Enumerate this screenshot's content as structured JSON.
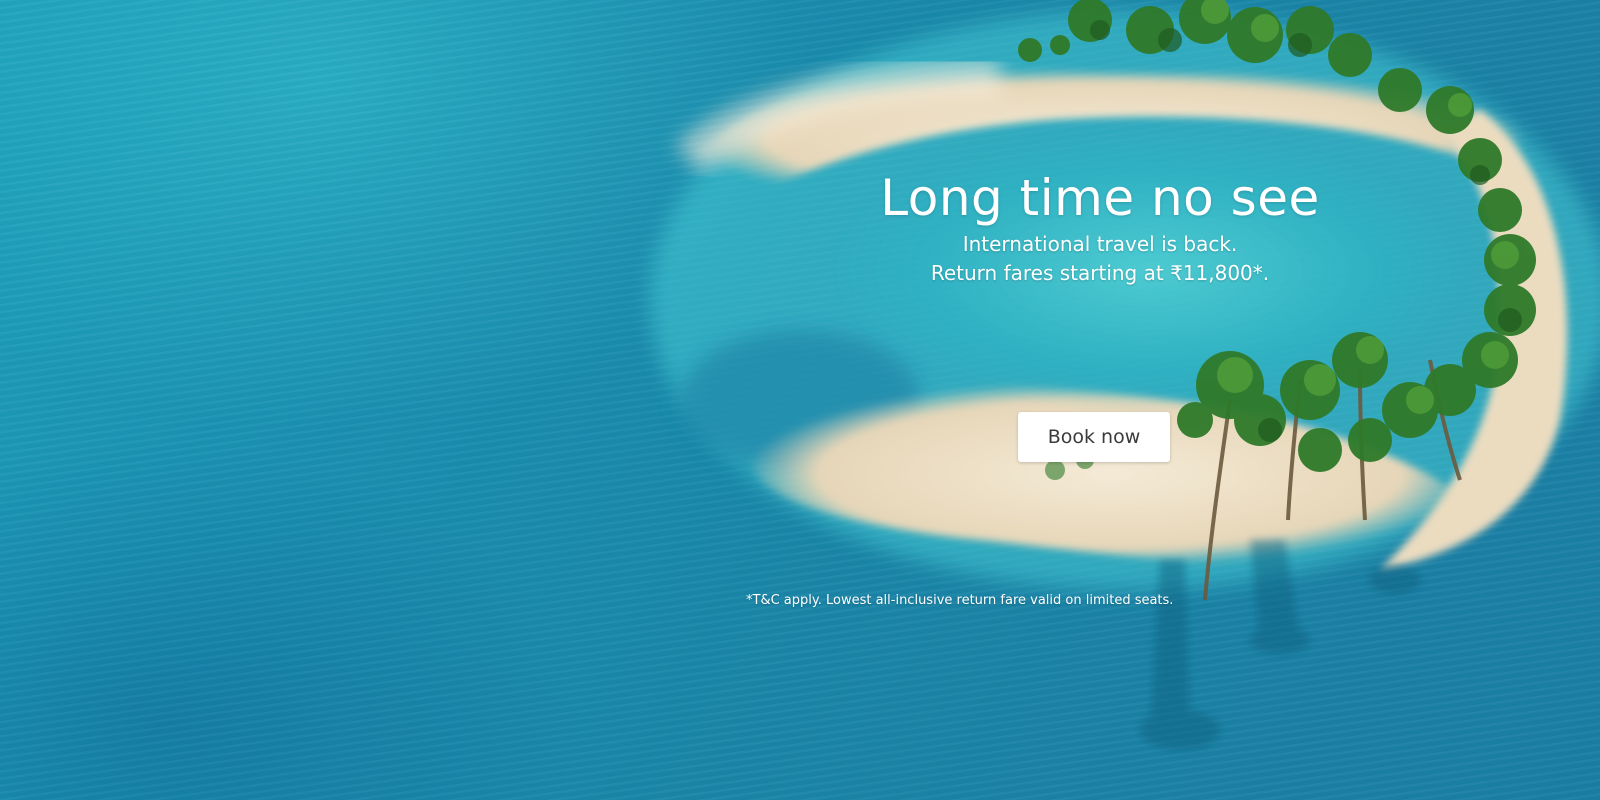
{
  "hero": {
    "title": "Long time no see",
    "subtitle_line1": "International travel is back.",
    "subtitle_line2": "Return fares starting at ₹11,800*.",
    "cta_label": "Book now",
    "disclaimer": "*T&C apply. Lowest all-inclusive return fare valid on limited seats."
  },
  "theme": {
    "sea": "#1a8fb0",
    "lagoon": "#3fc6cf",
    "sand": "#efe3cc",
    "palm": "#2f7a2a",
    "button_bg": "#ffffff",
    "button_text": "#3b3b3b"
  }
}
